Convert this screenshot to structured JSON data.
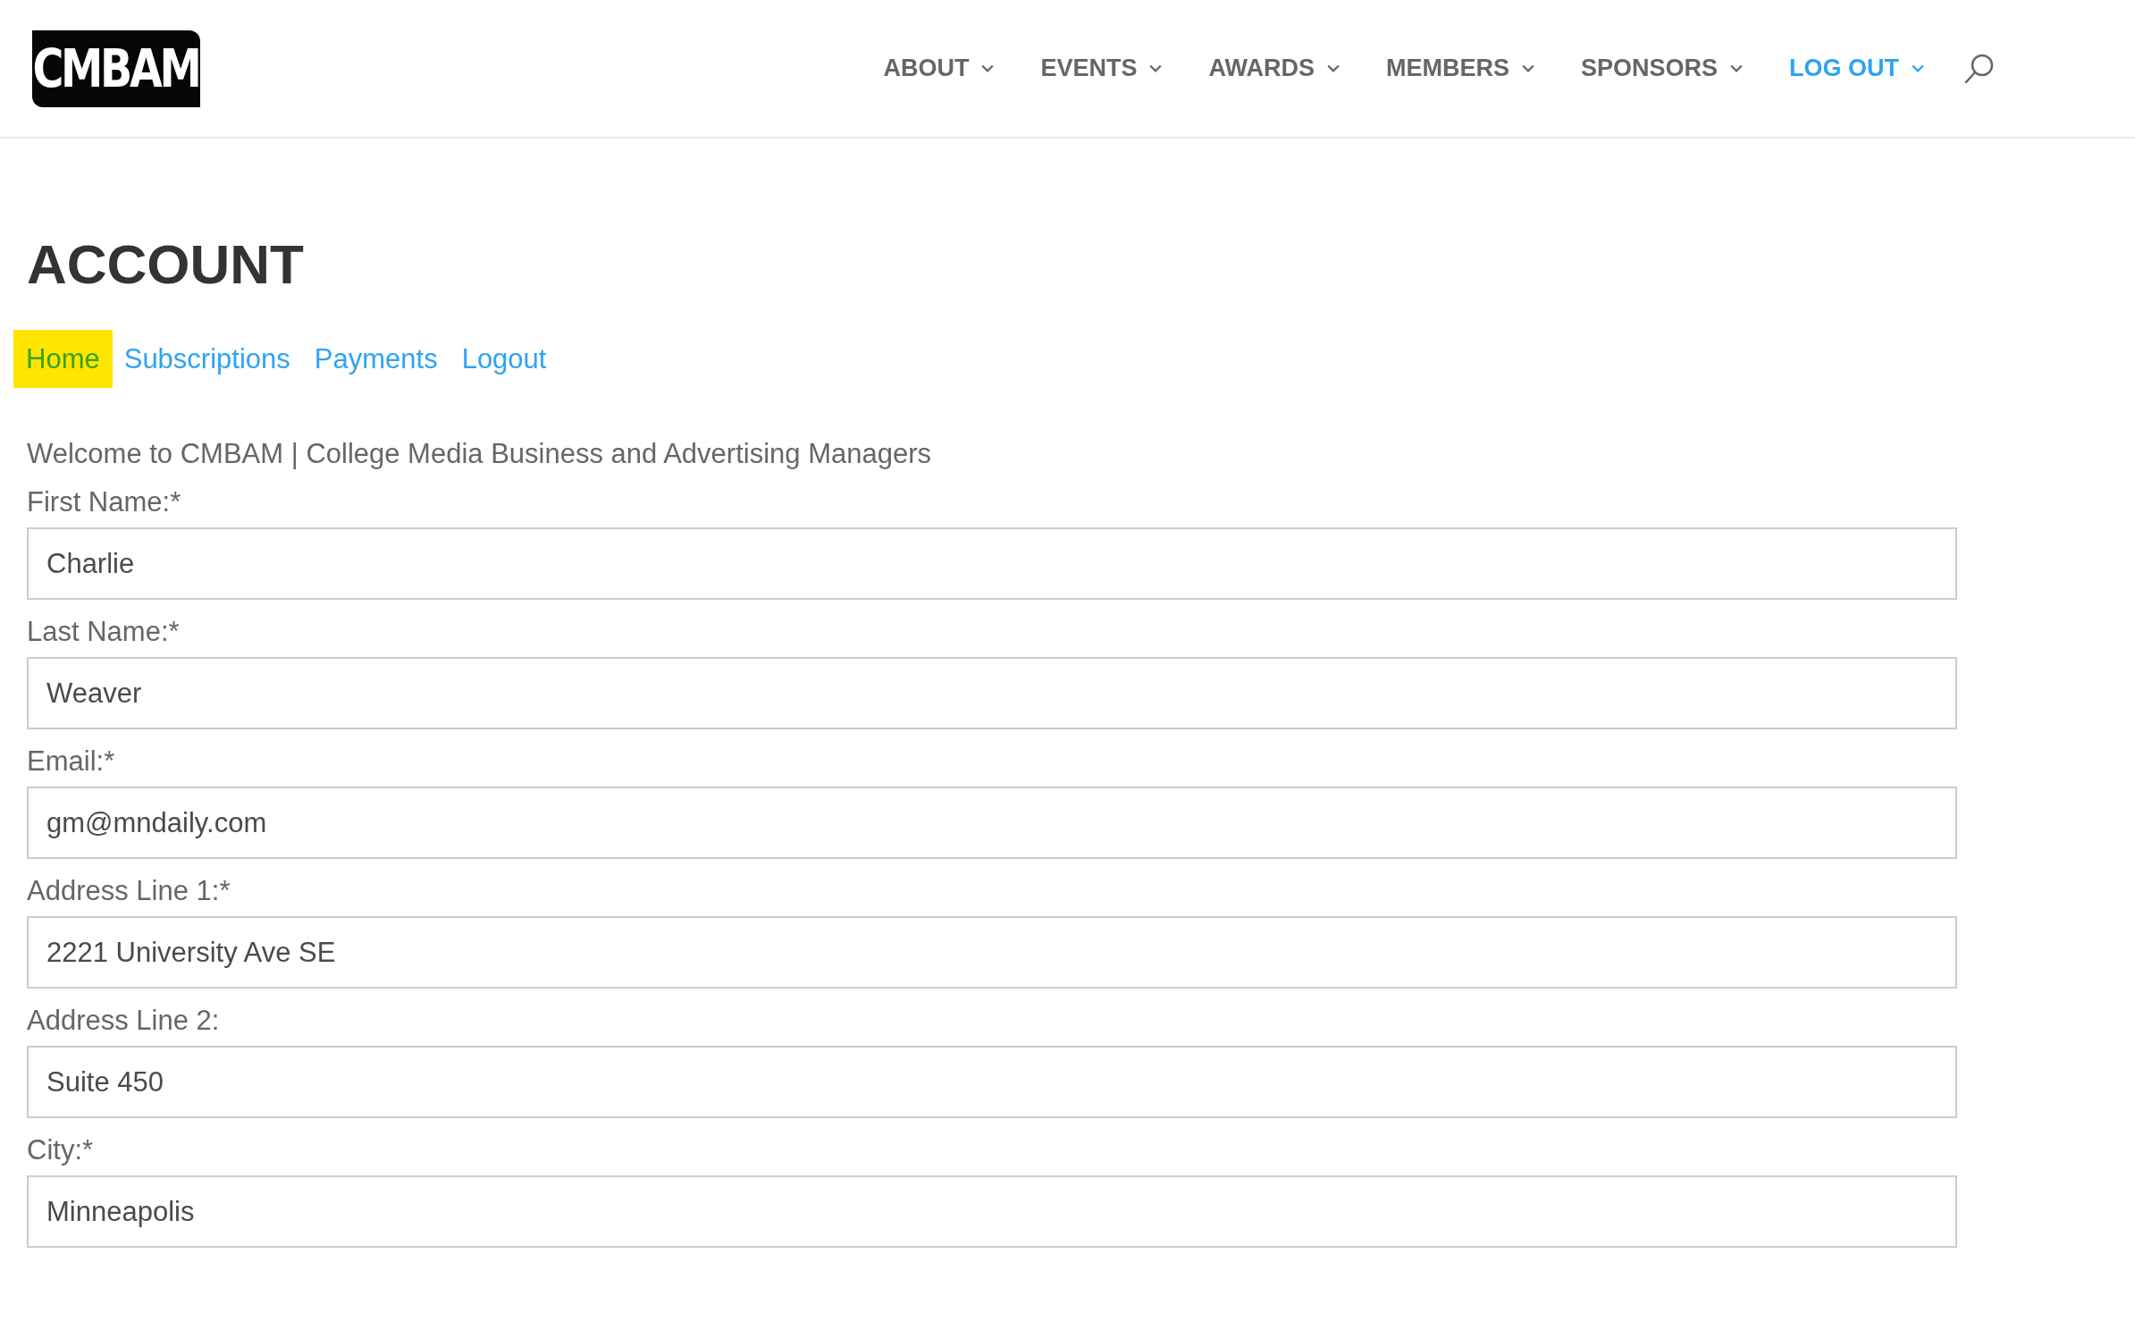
{
  "logo": {
    "text": "CMBAM"
  },
  "nav": [
    {
      "label": "ABOUT",
      "selected": false
    },
    {
      "label": "EVENTS",
      "selected": false
    },
    {
      "label": "AWARDS",
      "selected": false
    },
    {
      "label": "MEMBERS",
      "selected": false
    },
    {
      "label": "SPONSORS",
      "selected": false
    },
    {
      "label": "LOG OUT",
      "selected": true
    }
  ],
  "page_title": "ACCOUNT",
  "tabs": [
    {
      "label": "Home",
      "selected": true
    },
    {
      "label": "Subscriptions",
      "selected": false
    },
    {
      "label": "Payments",
      "selected": false
    },
    {
      "label": "Logout",
      "selected": false
    }
  ],
  "welcome": "Welcome to CMBAM | College Media Business and Advertising Managers",
  "fields": [
    {
      "label": "First Name:*",
      "value": "Charlie"
    },
    {
      "label": "Last Name:*",
      "value": "Weaver"
    },
    {
      "label": "Email:*",
      "value": "gm@mndaily.com"
    },
    {
      "label": "Address Line 1:*",
      "value": "2221 University Ave SE"
    },
    {
      "label": "Address Line 2:",
      "value": "Suite 450"
    },
    {
      "label": "City:*",
      "value": "Minneapolis"
    }
  ]
}
